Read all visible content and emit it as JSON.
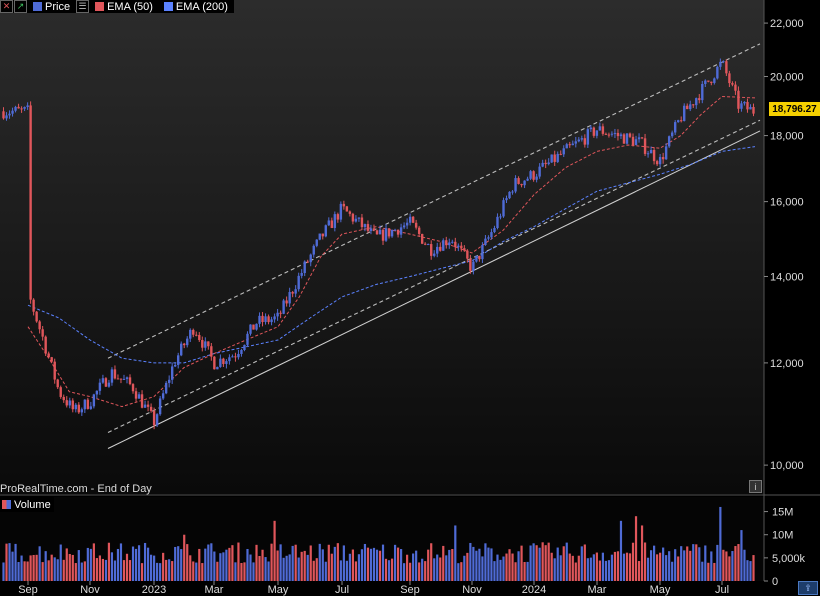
{
  "toolbar": {
    "price_label": "Price",
    "ema50_label": "EMA (50)",
    "ema200_label": "EMA (200)",
    "colors": {
      "price": "#4f6bd6",
      "ema50": "#e0565b",
      "ema200": "#5b82ff"
    }
  },
  "source_label": "ProRealTime.com - End of Day",
  "last_price_label": "18,796.27",
  "volume_label": "Volume",
  "chart_data": [
    {
      "type": "candlestick",
      "ylim": [
        9600,
        22600
      ],
      "y_ticks": [
        10000,
        12000,
        14000,
        16000,
        18000,
        20000,
        22000
      ],
      "y_tick_labels": [
        "10,000",
        "12,000",
        "14,000",
        "16,000",
        "18,000",
        "20,000",
        "22,000"
      ],
      "x_tick_labels": [
        "Sep",
        "Nov",
        "2023",
        "Mar",
        "May",
        "Jul",
        "Sep",
        "Nov",
        "2024",
        "Mar",
        "May",
        "Jul"
      ],
      "last_price": 18796.27,
      "grid": false,
      "colors": {
        "up": "#4f6bd6",
        "down": "#e0565b"
      },
      "close_path": [
        [
          "Sep",
          13600
        ],
        [
          "",
          12500
        ],
        [
          "",
          11400
        ],
        [
          "",
          11000
        ],
        [
          "Nov",
          11200
        ],
        [
          "",
          11800
        ],
        [
          "",
          11500
        ],
        [
          "2023",
          10800
        ],
        [
          "",
          12000
        ],
        [
          "",
          12800
        ],
        [
          "Mar",
          12000
        ],
        [
          "",
          12200
        ],
        [
          "",
          12900
        ],
        [
          "May",
          13000
        ],
        [
          "",
          14000
        ],
        [
          "",
          15000
        ],
        [
          "Jul",
          15800
        ],
        [
          "",
          15000
        ],
        [
          "Sep",
          15400
        ],
        [
          "",
          14700
        ],
        [
          "",
          15000
        ],
        [
          "Nov",
          14200
        ],
        [
          "",
          15200
        ],
        [
          "",
          16500
        ],
        [
          "2024",
          16800
        ],
        [
          "",
          17500
        ],
        [
          "Mar",
          18200
        ],
        [
          "",
          18000
        ],
        [
          "",
          17800
        ],
        [
          "May",
          17200
        ],
        [
          "",
          18600
        ],
        [
          "",
          19500
        ],
        [
          "Jul",
          20500
        ],
        [
          "",
          19000
        ],
        [
          "",
          18796.27
        ]
      ],
      "ema50": [
        [
          "Sep",
          12800
        ],
        [
          "",
          12100
        ],
        [
          "",
          11400
        ],
        [
          "Nov",
          11300
        ],
        [
          "",
          11100
        ],
        [
          "2023",
          11300
        ],
        [
          "",
          11900
        ],
        [
          "Mar",
          12200
        ],
        [
          "",
          12500
        ],
        [
          "May",
          12800
        ],
        [
          "",
          13500
        ],
        [
          "",
          14500
        ],
        [
          "Jul",
          15100
        ],
        [
          "",
          15300
        ],
        [
          "Sep",
          15100
        ],
        [
          "",
          14900
        ],
        [
          "Nov",
          14600
        ],
        [
          "",
          15200
        ],
        [
          "2024",
          16200
        ],
        [
          "",
          17000
        ],
        [
          "Mar",
          17500
        ],
        [
          "",
          17700
        ],
        [
          "May",
          17600
        ],
        [
          "",
          18000
        ],
        [
          "",
          18700
        ],
        [
          "Jul",
          19300
        ],
        [
          "",
          19250
        ]
      ],
      "ema200": [
        [
          "Sep",
          13300
        ],
        [
          "",
          13000
        ],
        [
          "Nov",
          12500
        ],
        [
          "",
          12100
        ],
        [
          "2023",
          12000
        ],
        [
          "",
          12000
        ],
        [
          "Mar",
          12200
        ],
        [
          "May",
          12500
        ],
        [
          "",
          13000
        ],
        [
          "Jul",
          13500
        ],
        [
          "",
          13800
        ],
        [
          "Sep",
          14000
        ],
        [
          "",
          14200
        ],
        [
          "Nov",
          14400
        ],
        [
          "",
          14900
        ],
        [
          "2024",
          15300
        ],
        [
          "",
          15800
        ],
        [
          "Mar",
          16300
        ],
        [
          "May",
          16800
        ],
        [
          "",
          17100
        ],
        [
          "Jul",
          17500
        ],
        [
          "",
          17650
        ]
      ],
      "trendlines": [
        {
          "style": "dashed",
          "from": [
            "2023",
            12100
          ],
          "to": [
            "Jul",
            21200
          ]
        },
        {
          "style": "dashed",
          "from": [
            "Nov",
            10600
          ],
          "to": [
            "Jul",
            18500
          ]
        },
        {
          "style": "solid",
          "from": [
            "Nov",
            10300
          ],
          "to": [
            "Jul",
            18150
          ]
        }
      ]
    },
    {
      "type": "bar",
      "name": "Volume",
      "y_ticks": [
        0,
        5000000,
        10000000,
        15000000
      ],
      "y_tick_labels": [
        "0",
        "5,000k",
        "10M",
        "15M"
      ],
      "ylim": [
        0,
        17500000
      ],
      "typical_volume": 7000000,
      "notable_peaks": [
        13000000,
        12000000,
        14000000,
        12000000,
        16000000,
        13000000,
        11000000,
        10000000
      ]
    }
  ]
}
